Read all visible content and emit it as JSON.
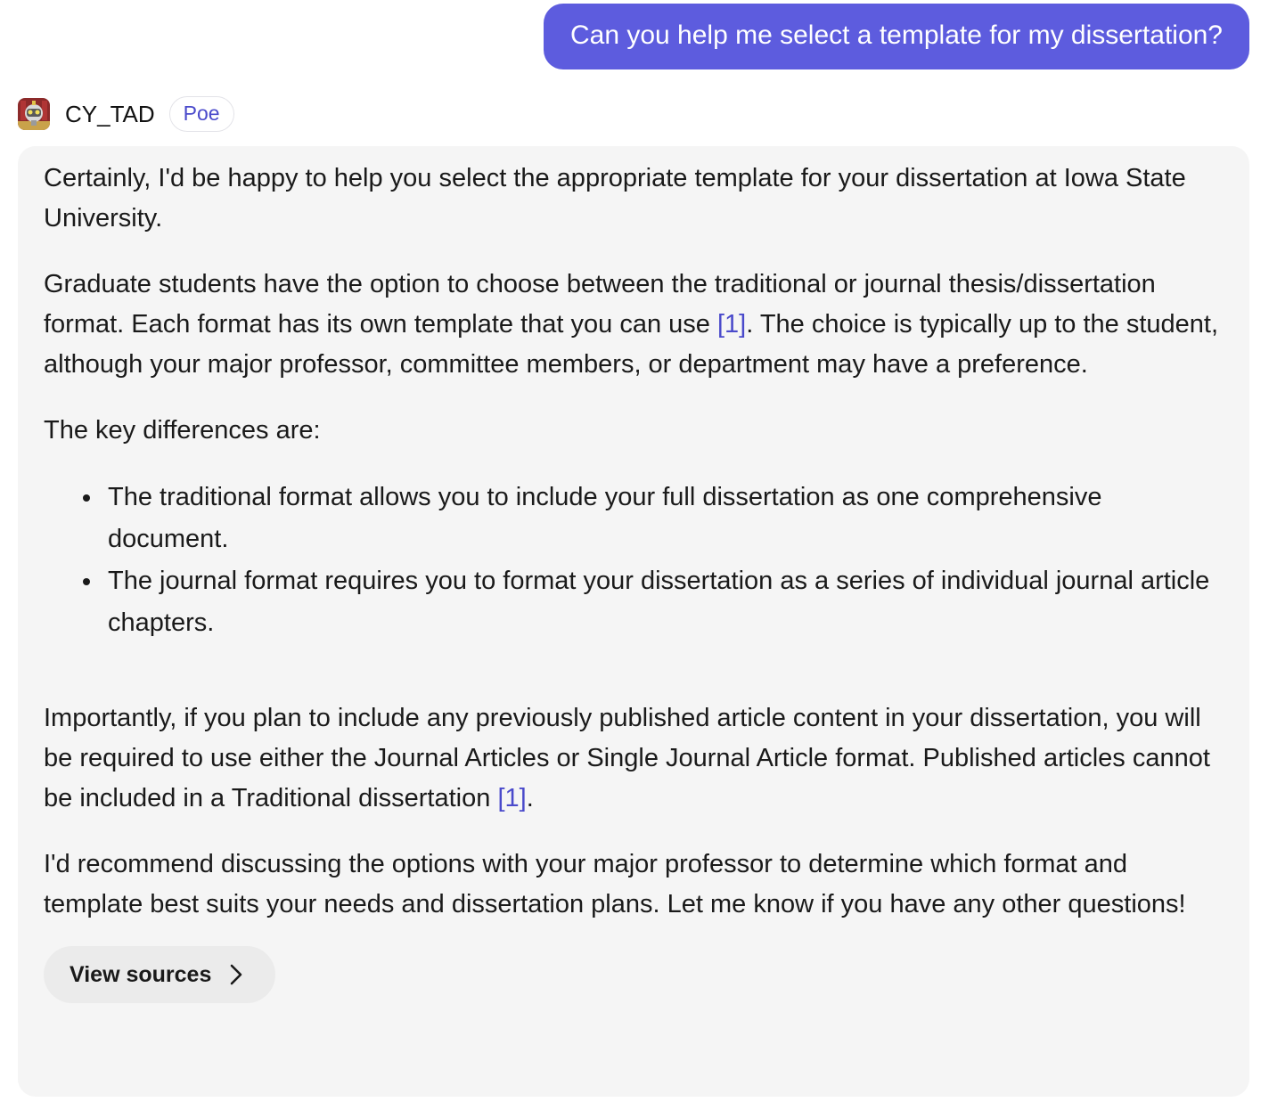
{
  "user_message": {
    "text": "Can you help me select a template for my dissertation?"
  },
  "bot": {
    "name": "CY_TAD",
    "badge": "Poe",
    "avatar_icon": "robot-mascot-icon"
  },
  "response": {
    "p1": "Certainly, I'd be happy to help you select the appropriate template for your dissertation at Iowa State University.",
    "p2_before": "Graduate students have the option to choose between the traditional or journal thesis/dissertation format. Each format has its own template that you can use ",
    "p2_cite": "[1]",
    "p2_after": ". The choice is typically up to the student, although your major professor, committee members, or department may have a preference.",
    "p3": "The key differences are:",
    "bullets": [
      "The traditional format allows you to include your full dissertation as one comprehensive document.",
      "The journal format requires you to format your dissertation as a series of individual journal article chapters."
    ],
    "p4_before": "Importantly, if you plan to include any previously published article content in your dissertation, you will be required to use either the Journal Articles or Single Journal Article format. Published articles cannot be included in a Traditional dissertation ",
    "p4_cite": "[1]",
    "p4_after": ".",
    "p5": "I'd recommend discussing the options with your major professor to determine which format and template best suits your needs and dissertation plans. Let me know if you have any other questions!"
  },
  "view_sources": {
    "label": "View sources",
    "icon": "chevron-right-icon"
  },
  "colors": {
    "user_bubble": "#5d5cde",
    "bot_bubble": "#f5f5f5",
    "citation": "#4a4acb",
    "badge_text": "#4a4acb"
  }
}
